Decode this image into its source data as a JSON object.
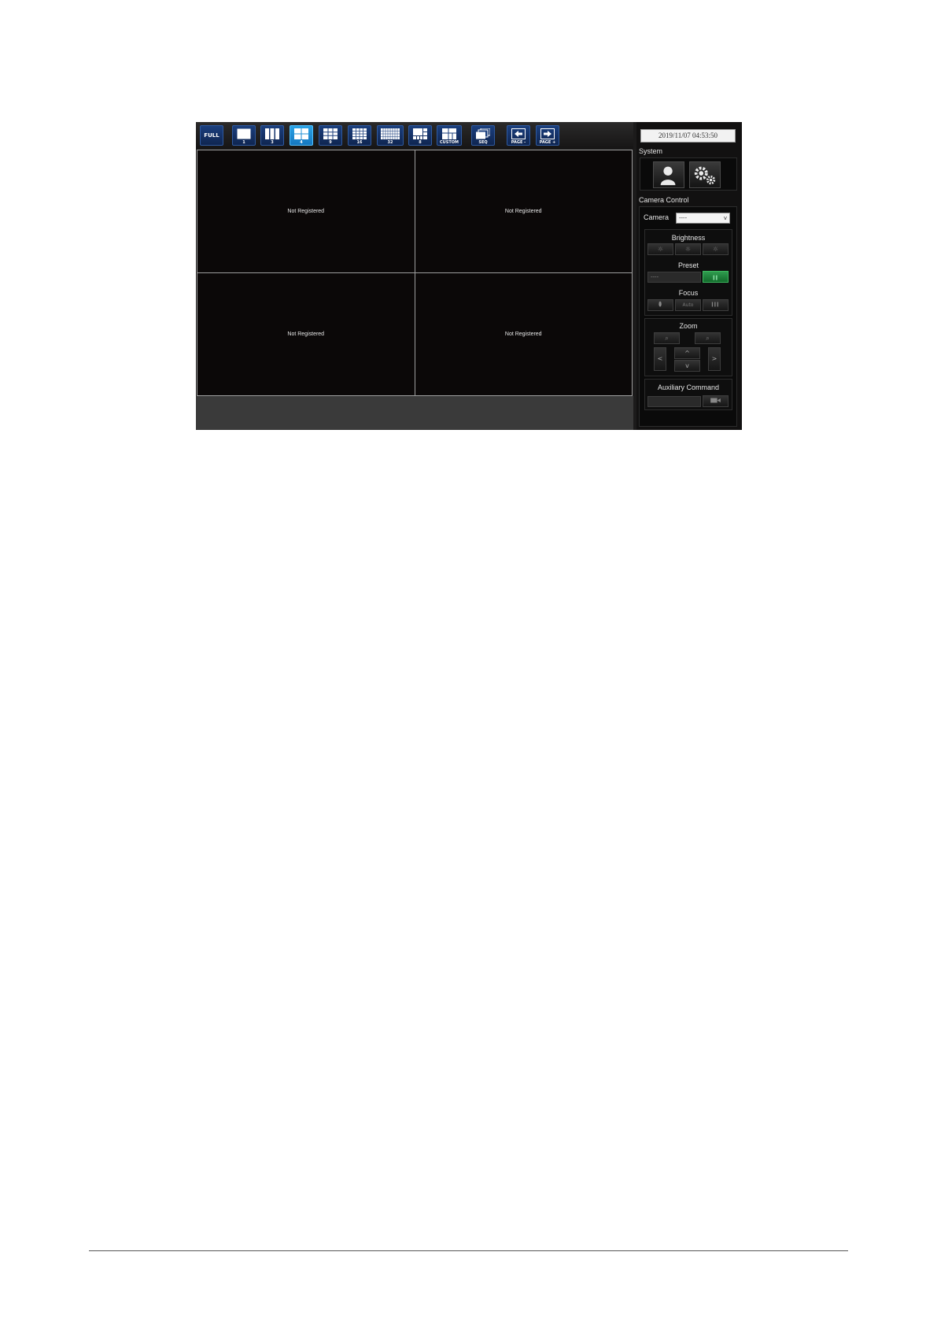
{
  "toolbar": {
    "buttons": [
      {
        "id": "full",
        "label": "FULL"
      },
      {
        "id": "l1",
        "label": "1"
      },
      {
        "id": "l3",
        "label": "3"
      },
      {
        "id": "l4",
        "label": "4",
        "active": true
      },
      {
        "id": "l9",
        "label": "9"
      },
      {
        "id": "l16",
        "label": "16"
      },
      {
        "id": "l32",
        "label": "32"
      },
      {
        "id": "l8",
        "label": "8"
      },
      {
        "id": "custom",
        "label": "CUSTOM"
      },
      {
        "id": "seq",
        "label": "SEQ"
      },
      {
        "id": "page_minus",
        "label": "PAGE -"
      },
      {
        "id": "page_plus",
        "label": "PAGE +"
      }
    ]
  },
  "grid": {
    "cells": [
      "Not Registered",
      "Not Registered",
      "Not Registered",
      "Not Registered"
    ]
  },
  "panel": {
    "datetime": "2019/11/07 04:53:50",
    "system_label": "System",
    "camera_control_label": "Camera Control",
    "camera_label": "Camera",
    "camera_select_value": "----",
    "brightness_label": "Brightness",
    "preset_label": "Preset",
    "preset_value": "----",
    "focus_label": "Focus",
    "focus_auto_label": "Auto",
    "zoom_label": "Zoom",
    "pan_left": "<",
    "pan_right": ">",
    "tilt_up": "^",
    "tilt_down": "v",
    "auxiliary_label": "Auxiliary Command"
  },
  "colors": {
    "toolbar_button": "#1b3f7e",
    "toolbar_button_active": "#2aa3e6",
    "preset_go": "#2f9b4e"
  }
}
